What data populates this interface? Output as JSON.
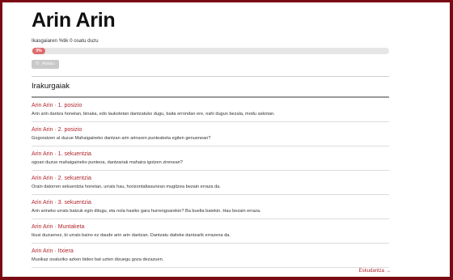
{
  "page": {
    "title": "Arin Arin",
    "progress_text": "Ikasgaiaren %tik 0 osatu duzu",
    "progress_percent": 0,
    "progress_label": "0%",
    "reset_label": "Abiatu",
    "reset_icon": "refresh-icon",
    "section_title": "Irakurgaiak",
    "footer_link": "Eskudantza",
    "footer_arrow": "→",
    "colors": {
      "frame": "#7a0a14",
      "accent": "#b0262e",
      "pill": "#e06a6a"
    }
  },
  "items": [
    {
      "title": "Arin Arin · 1. posizio",
      "desc": "Arin arin dantza honetan, binaka, edo laukotetan dantzatuko dugu, baita errondan ere, nahi dugun bezala, modu askotan."
    },
    {
      "title": "Arin Arin · 2. posizio",
      "desc": "Gogoratzen al duzue Mahaigaineko dantzan arin arinaren punteaketa egiten genuenean?"
    },
    {
      "title": "Arin Arin · 1. sekuentzia",
      "desc": "ogoan duzue mahaigaineko punteoa, dantzariak mahaira igotzen zirenean?"
    },
    {
      "title": "Arin Arin · 2. sekuentzia",
      "desc": "Orain datorren sekuentzia honetan, urrats hau, horizontaltasunean mugitzea bezain erraza da."
    },
    {
      "title": "Arin Arin · 3. sekuentzia",
      "desc": "Arin arineko urrats batzuk egin ditugu, eta nola hasiko gara hurrengoarekin? Ba bueltа batekin. Hau bezain erraza."
    },
    {
      "title": "Arin Arin · Muntaketa",
      "desc": "Ikusi duzuenez, bi urrats baino ez daude arin arin dantzan. Dantzatu daiteke dantzarik errazena da."
    },
    {
      "title": "Arin Arin · Itxiera",
      "desc": "Musikaz osaturiko azken bideo bat uzten dizuegu goza dezazuen."
    }
  ]
}
